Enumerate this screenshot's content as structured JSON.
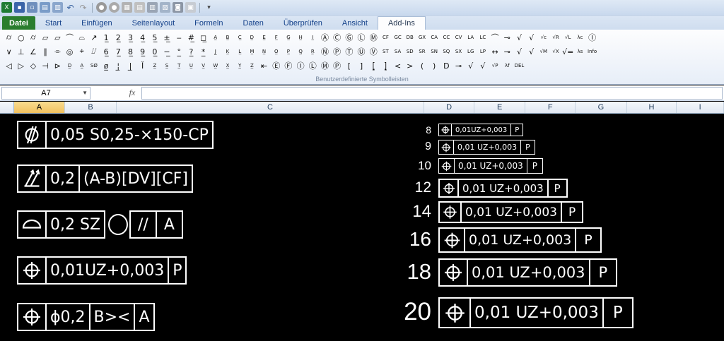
{
  "app": {
    "tabs": [
      {
        "label": "Datei"
      },
      {
        "label": "Start"
      },
      {
        "label": "Einfügen"
      },
      {
        "label": "Seitenlayout"
      },
      {
        "label": "Formeln"
      },
      {
        "label": "Daten"
      },
      {
        "label": "Überprüfen"
      },
      {
        "label": "Ansicht"
      },
      {
        "label": "Add-Ins"
      }
    ],
    "active_tab": "Add-Ins",
    "ribbon_group_caption": "Benutzerdefinierte Symbolleisten"
  },
  "ribbon_symbols": {
    "row1": [
      "⌭",
      "○",
      "⌭",
      "⏥",
      "▱",
      "⌒",
      "⌓",
      "↗",
      "1̲",
      "2̲",
      "3̲",
      "4̲",
      "5̲",
      "±̲",
      "‒",
      "#̲",
      "◻̲",
      "A̲",
      "B̲",
      "C̲",
      "D̲",
      "E̲",
      "F̲",
      "G̲",
      "H̲",
      "I̲",
      "Ⓐ",
      "Ⓒ",
      "Ⓖ",
      "Ⓛ",
      "Ⓜ",
      "CF",
      "GC",
      "DB",
      "GX",
      "CA",
      "CC",
      "CV",
      "LA",
      "LC",
      "⌒",
      "⊸",
      "√",
      "√",
      "√c",
      "√R",
      "√L",
      "λc",
      "Ⓘ"
    ],
    "row2": [
      "∨",
      "⊥",
      "∠",
      "∥",
      "⌯",
      "◎",
      "⌖",
      "⌰",
      "6̲",
      "7̲",
      "8̲",
      "9̲",
      "0̲",
      "−̲",
      "°̲",
      "?̲",
      "*̲",
      "J̲",
      "K̲",
      "L̲",
      "M̲",
      "N̲",
      "O̲",
      "P̲",
      "Q̲",
      "R̲",
      "Ⓝ",
      "Ⓟ",
      "Ⓣ",
      "Ⓤ",
      "Ⓥ",
      "ST",
      "SA",
      "SD",
      "SR",
      "SN",
      "SQ",
      "SX",
      "LG",
      "LP",
      "↔",
      "⊸",
      "√",
      "√",
      "√M",
      "√X",
      "√=",
      "λs",
      "Info"
    ],
    "row3": [
      "◁",
      "▷",
      "◇",
      "⊣",
      "⊳",
      "D̲",
      "A̲",
      "SØ",
      "ø̲",
      "¦̲",
      "|̲",
      "Ǐ",
      "Z̲",
      "S̲",
      "T̲",
      "U̲",
      "V̲",
      "W̲",
      "X̲",
      "Y̲",
      "Z̲",
      "⇤",
      "Ⓔ",
      "Ⓕ",
      "Ⓘ",
      "Ⓛ",
      "Ⓜ",
      "Ⓟ",
      "[",
      "]",
      "⦋",
      "⦌",
      "<",
      ">",
      "(",
      ")",
      "D",
      "⊸",
      "√",
      "√",
      "√P",
      "λf",
      "DEL"
    ]
  },
  "formula_bar": {
    "name_box": "A7",
    "fx_label": "fx",
    "formula": ""
  },
  "columns": [
    {
      "label": "A",
      "active": true
    },
    {
      "label": "B",
      "active": false
    },
    {
      "label": "C",
      "active": false
    },
    {
      "label": "D",
      "active": false
    },
    {
      "label": "E",
      "active": false
    },
    {
      "label": "F",
      "active": false
    },
    {
      "label": "G",
      "active": false
    },
    {
      "label": "H",
      "active": false
    },
    {
      "label": "I",
      "active": false
    }
  ],
  "left_frames": [
    {
      "symbol": "cylindricity-icon",
      "cells": [
        "0,05 S0,25-×150-CP"
      ]
    },
    {
      "symbol": "total-runout-icon",
      "cells": [
        "0,2",
        "(A-B)[DV][CF]"
      ]
    },
    {
      "symbol": "profile-surface-icon",
      "cells": [
        "0,2 SZ"
      ],
      "extra": [
        "○",
        "//",
        "A"
      ]
    },
    {
      "symbol": "position-icon",
      "cells": [
        "0,01UZ+0,003",
        "P"
      ]
    },
    {
      "symbol": "position-icon",
      "cells": [
        "ϕ0,2",
        "B><",
        "A"
      ]
    }
  ],
  "size_samples": [
    {
      "size": "8",
      "tolerance": "0,01UZ+0,003",
      "datum": "P"
    },
    {
      "size": "9",
      "tolerance": "0,01 UZ+0,003",
      "datum": "P"
    },
    {
      "size": "10",
      "tolerance": "0,01 UZ+0,003",
      "datum": "P"
    },
    {
      "size": "12",
      "tolerance": "0,01 UZ+0,003",
      "datum": "P"
    },
    {
      "size": "14",
      "tolerance": "0,01 UZ+0,003",
      "datum": "P"
    },
    {
      "size": "16",
      "tolerance": "0,01 UZ+0,003",
      "datum": "P"
    },
    {
      "size": "18",
      "tolerance": "0,01 UZ+0,003",
      "datum": "P"
    },
    {
      "size": "20",
      "tolerance": "0,01 UZ+0,003",
      "datum": "P"
    }
  ]
}
